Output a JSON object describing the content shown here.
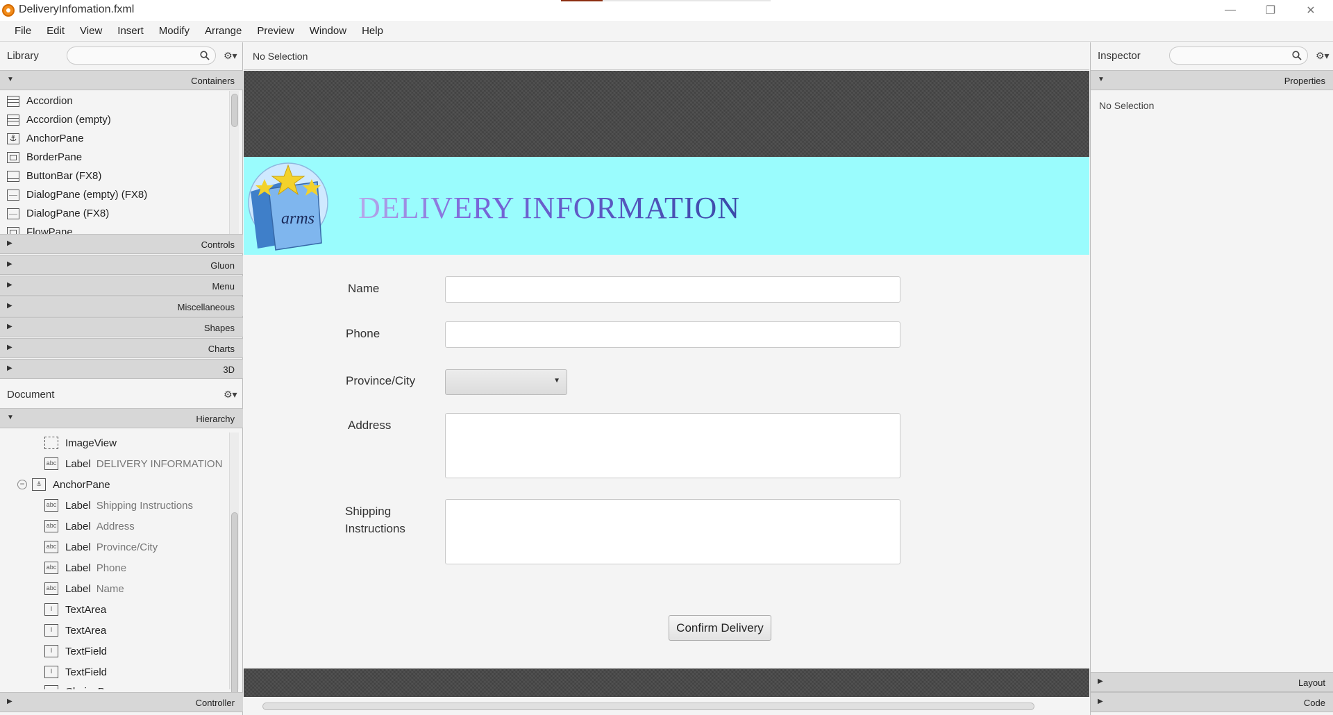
{
  "window": {
    "title": "DeliveryInfomation.fxml",
    "controls": {
      "minimize": "—",
      "maximize": "❐",
      "close": "✕"
    }
  },
  "menu": [
    "File",
    "Edit",
    "View",
    "Insert",
    "Modify",
    "Arrange",
    "Preview",
    "Window",
    "Help"
  ],
  "library": {
    "title": "Library",
    "search_placeholder": "",
    "containers_label": "Containers",
    "items": [
      {
        "label": "Accordion",
        "icon": "accordion-icon"
      },
      {
        "label": "Accordion  (empty)",
        "icon": "accordion-icon"
      },
      {
        "label": "AnchorPane",
        "icon": "anchorpane-icon"
      },
      {
        "label": "BorderPane",
        "icon": "borderpane-icon"
      },
      {
        "label": "ButtonBar  (FX8)",
        "icon": "buttonbar-icon"
      },
      {
        "label": "DialogPane (empty)  (FX8)",
        "icon": "dialogpane-icon"
      },
      {
        "label": "DialogPane  (FX8)",
        "icon": "dialogpane-icon"
      },
      {
        "label": "FlowPane",
        "icon": "flowpane-icon"
      }
    ],
    "sections": [
      "Controls",
      "Gluon",
      "Menu",
      "Miscellaneous",
      "Shapes",
      "Charts",
      "3D"
    ]
  },
  "document": {
    "title": "Document",
    "hierarchy_label": "Hierarchy",
    "controller_label": "Controller",
    "tree": [
      {
        "type": "ImageView",
        "value": "",
        "icon": "abc"
      },
      {
        "type": "Label",
        "value": "DELIVERY INFORMATION",
        "icon": "abc"
      },
      {
        "type": "AnchorPane",
        "value": "",
        "icon": "⚓"
      },
      {
        "type": "Label",
        "value": "Shipping Instructions",
        "icon": "abc"
      },
      {
        "type": "Label",
        "value": "Address",
        "icon": "abc"
      },
      {
        "type": "Label",
        "value": "Province/City",
        "icon": "abc"
      },
      {
        "type": "Label",
        "value": "Phone",
        "icon": "abc"
      },
      {
        "type": "Label",
        "value": "Name",
        "icon": "abc"
      },
      {
        "type": "TextArea",
        "value": "",
        "icon": "I"
      },
      {
        "type": "TextArea",
        "value": "",
        "icon": "I"
      },
      {
        "type": "TextField",
        "value": "",
        "icon": "I"
      },
      {
        "type": "TextField",
        "value": "",
        "icon": "I"
      },
      {
        "type": "ChoiceBox",
        "value": "",
        "icon": "▾"
      }
    ]
  },
  "canvas": {
    "selection_status": "No Selection",
    "banner_title": "DELIVERY INFORMATION",
    "logo_text": "arms",
    "form": {
      "name_label": "Name",
      "name_value": "",
      "phone_label": "Phone",
      "phone_value": "",
      "province_label": "Province/City",
      "province_value": "",
      "address_label": "Address",
      "address_value": "",
      "shipping_label_line1": "Shipping",
      "shipping_label_line2": "Instructions",
      "shipping_value": "",
      "confirm_button": "Confirm Delivery"
    }
  },
  "inspector": {
    "title": "Inspector",
    "properties_label": "Properties",
    "status": "No Selection",
    "layout_label": "Layout",
    "code_label": "Code"
  }
}
